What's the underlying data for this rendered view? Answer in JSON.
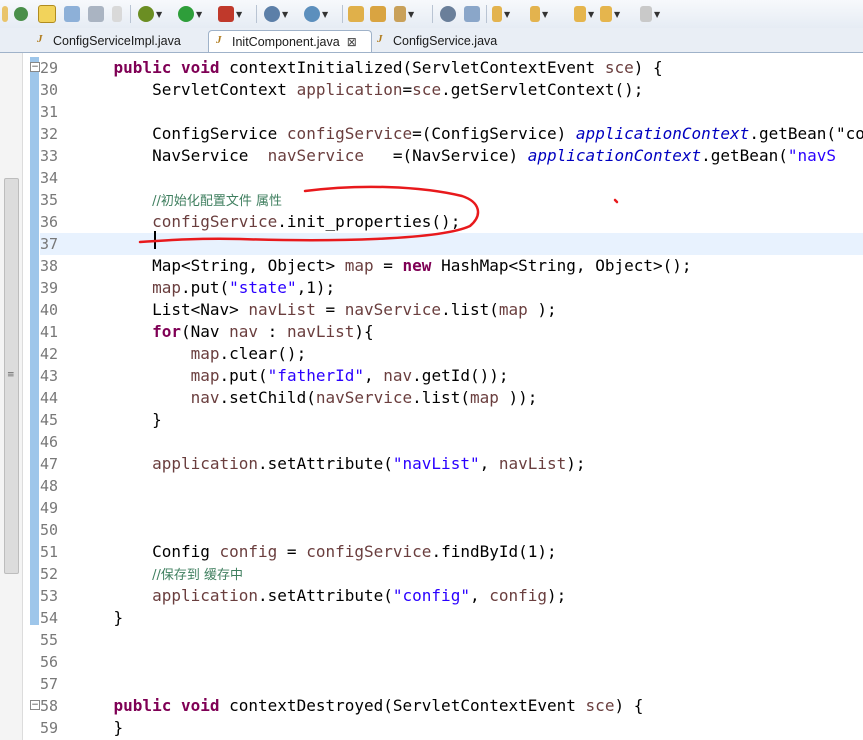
{
  "toolbar": {
    "icons": [
      "package-icon",
      "sync-icon",
      "toggle-icon",
      "save-icon",
      "debug-icon",
      "run-icon",
      "external-tools-icon",
      "new-java-project-icon",
      "new-class-icon",
      "open-type-icon",
      "open-folder-icon",
      "pen-icon",
      "search-icon",
      "next-annotation-icon",
      "prev-annotation-icon",
      "back-icon",
      "forward-icon"
    ]
  },
  "tabs": [
    {
      "label": "ConfigServiceImpl.java",
      "active": false
    },
    {
      "label": "InitComponent.java",
      "active": true,
      "close": "⊠"
    },
    {
      "label": "ConfigService.java",
      "active": false
    }
  ],
  "editor": {
    "lines": [
      {
        "n": "29",
        "fold": "−",
        "html": "    <span class='kw'>public</span> <span class='kw'>void</span> contextInitialized(ServletContextEvent <span class='var'>sce</span>) {"
      },
      {
        "n": "30",
        "html": "        ServletContext <span class='var'>application</span>=<span class='var'>sce</span>.getServletContext();"
      },
      {
        "n": "31",
        "html": ""
      },
      {
        "n": "32",
        "html": "        ConfigService <span class='var'>configService</span>=(ConfigService) <span class='fld'>applicationContext</span>.getBean(\"co"
      },
      {
        "n": "33",
        "html": "        NavService  <span class='var'>navService</span>   =(NavService) <span class='fld'>applicationContext</span>.getBean(<span class='str'>\"navS</span>"
      },
      {
        "n": "34",
        "html": ""
      },
      {
        "n": "35",
        "html": "        <span class='com'>//初始化配置文件 属性</span>"
      },
      {
        "n": "36",
        "html": "        <span class='var'>configService</span>.init_properties();"
      },
      {
        "n": "37",
        "html": "",
        "current": true
      },
      {
        "n": "38",
        "html": "        Map&lt;String, Object&gt; <span class='var'>map</span> = <span class='kw'>new</span> HashMap&lt;String, Object&gt;();"
      },
      {
        "n": "39",
        "html": "        <span class='var'>map</span>.put(<span class='str'>\"state\"</span>,1);"
      },
      {
        "n": "40",
        "html": "        List&lt;Nav&gt; <span class='var'>navList</span> = <span class='var'>navService</span>.list(<span class='var'>map</span> );"
      },
      {
        "n": "41",
        "html": "        <span class='kw'>for</span>(Nav <span class='var'>nav</span> : <span class='var'>navList</span>){"
      },
      {
        "n": "42",
        "html": "            <span class='var'>map</span>.clear();"
      },
      {
        "n": "43",
        "html": "            <span class='var'>map</span>.put(<span class='str'>\"fatherId\"</span>, <span class='var'>nav</span>.getId());"
      },
      {
        "n": "44",
        "html": "            <span class='var'>nav</span>.setChild(<span class='var'>navService</span>.list(<span class='var'>map</span> ));"
      },
      {
        "n": "45",
        "html": "        }"
      },
      {
        "n": "46",
        "html": ""
      },
      {
        "n": "47",
        "html": "        <span class='var'>application</span>.setAttribute(<span class='str'>\"navList\"</span>, <span class='var'>navList</span>);"
      },
      {
        "n": "48",
        "html": ""
      },
      {
        "n": "49",
        "html": ""
      },
      {
        "n": "50",
        "html": ""
      },
      {
        "n": "51",
        "html": "        Config <span class='var'>config</span> = <span class='var'>configService</span>.findById(1);"
      },
      {
        "n": "52",
        "html": "        <span class='com'>//保存到 缓存中</span>"
      },
      {
        "n": "53",
        "html": "        <span class='var'>application</span>.setAttribute(<span class='str'>\"config\"</span>, <span class='var'>config</span>);"
      },
      {
        "n": "54",
        "html": "    }"
      },
      {
        "n": "55",
        "html": ""
      },
      {
        "n": "56",
        "html": ""
      },
      {
        "n": "57",
        "html": ""
      },
      {
        "n": "58",
        "fold": "−",
        "html": "    <span class='kw'>public</span> <span class='kw'>void</span> contextDestroyed(ServletContextEvent <span class='var'>sce</span>) {"
      },
      {
        "n": "59",
        "html": "    }"
      }
    ]
  },
  "annotation": {
    "color": "#e8191c"
  },
  "colors": {
    "keyword": "#7f0055",
    "field": "#0000c0",
    "local": "#6a3e3e",
    "string": "#2a00ff",
    "comment": "#3f7f5f",
    "current_line": "#e8f2fe",
    "change_bar": "#9ec6ea"
  }
}
